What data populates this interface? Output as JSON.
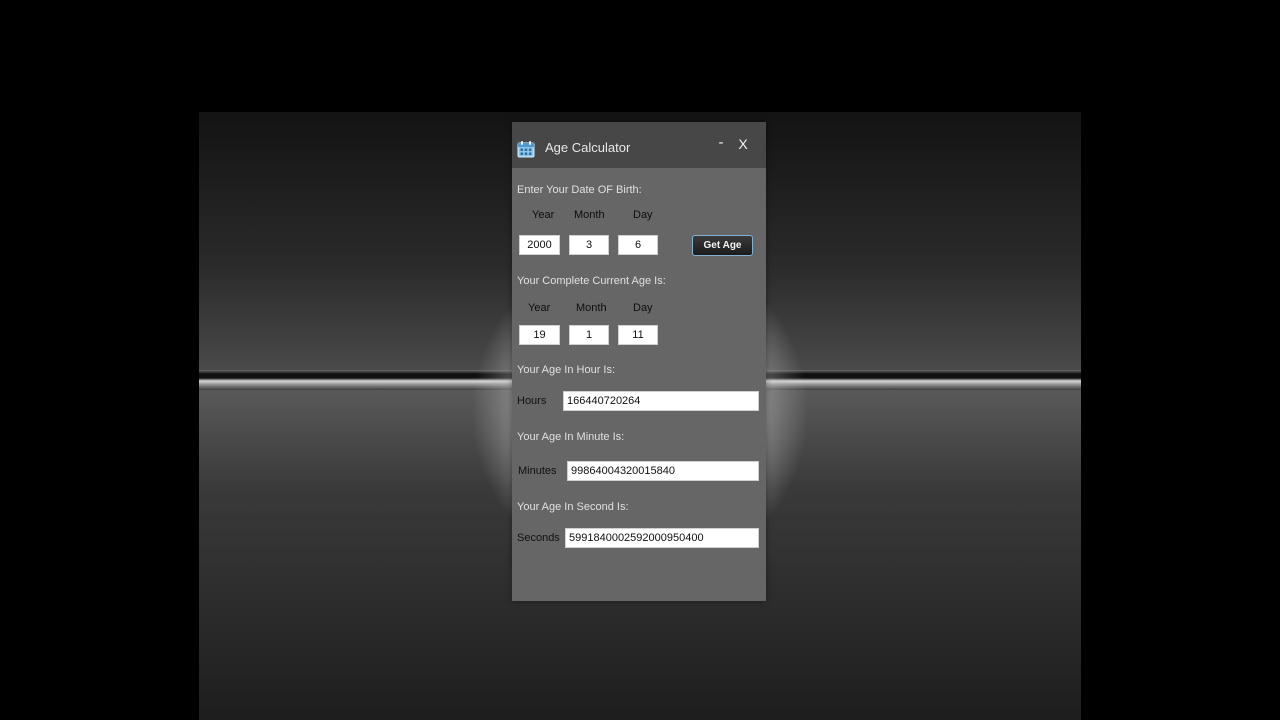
{
  "window": {
    "title": "Age Calculator",
    "minimize_label": "-",
    "close_label": "X"
  },
  "birth": {
    "heading": "Enter Your Date OF Birth:",
    "year_label": "Year",
    "month_label": "Month",
    "day_label": "Day",
    "year": "2000",
    "month": "3",
    "day": "6",
    "button_label": "Get Age"
  },
  "current_age": {
    "heading": "Your Complete Current Age Is:",
    "year_label": "Year",
    "month_label": "Month",
    "day_label": "Day",
    "year": "19",
    "month": "1",
    "day": "11"
  },
  "hours": {
    "heading": "Your Age In Hour Is:",
    "label": "Hours",
    "value": "166440720264"
  },
  "minutes": {
    "heading": "Your Age In Minute Is:",
    "label": "Minutes",
    "value": "99864004320015840"
  },
  "seconds": {
    "heading": "Your Age In Second Is:",
    "label": "Seconds",
    "value": "5991840002592000950400"
  },
  "icons": {
    "app": "calendar-icon"
  },
  "colors": {
    "window_bg": "#666666",
    "titlebar_bg": "#474747",
    "button_border": "#7fb3d6"
  }
}
